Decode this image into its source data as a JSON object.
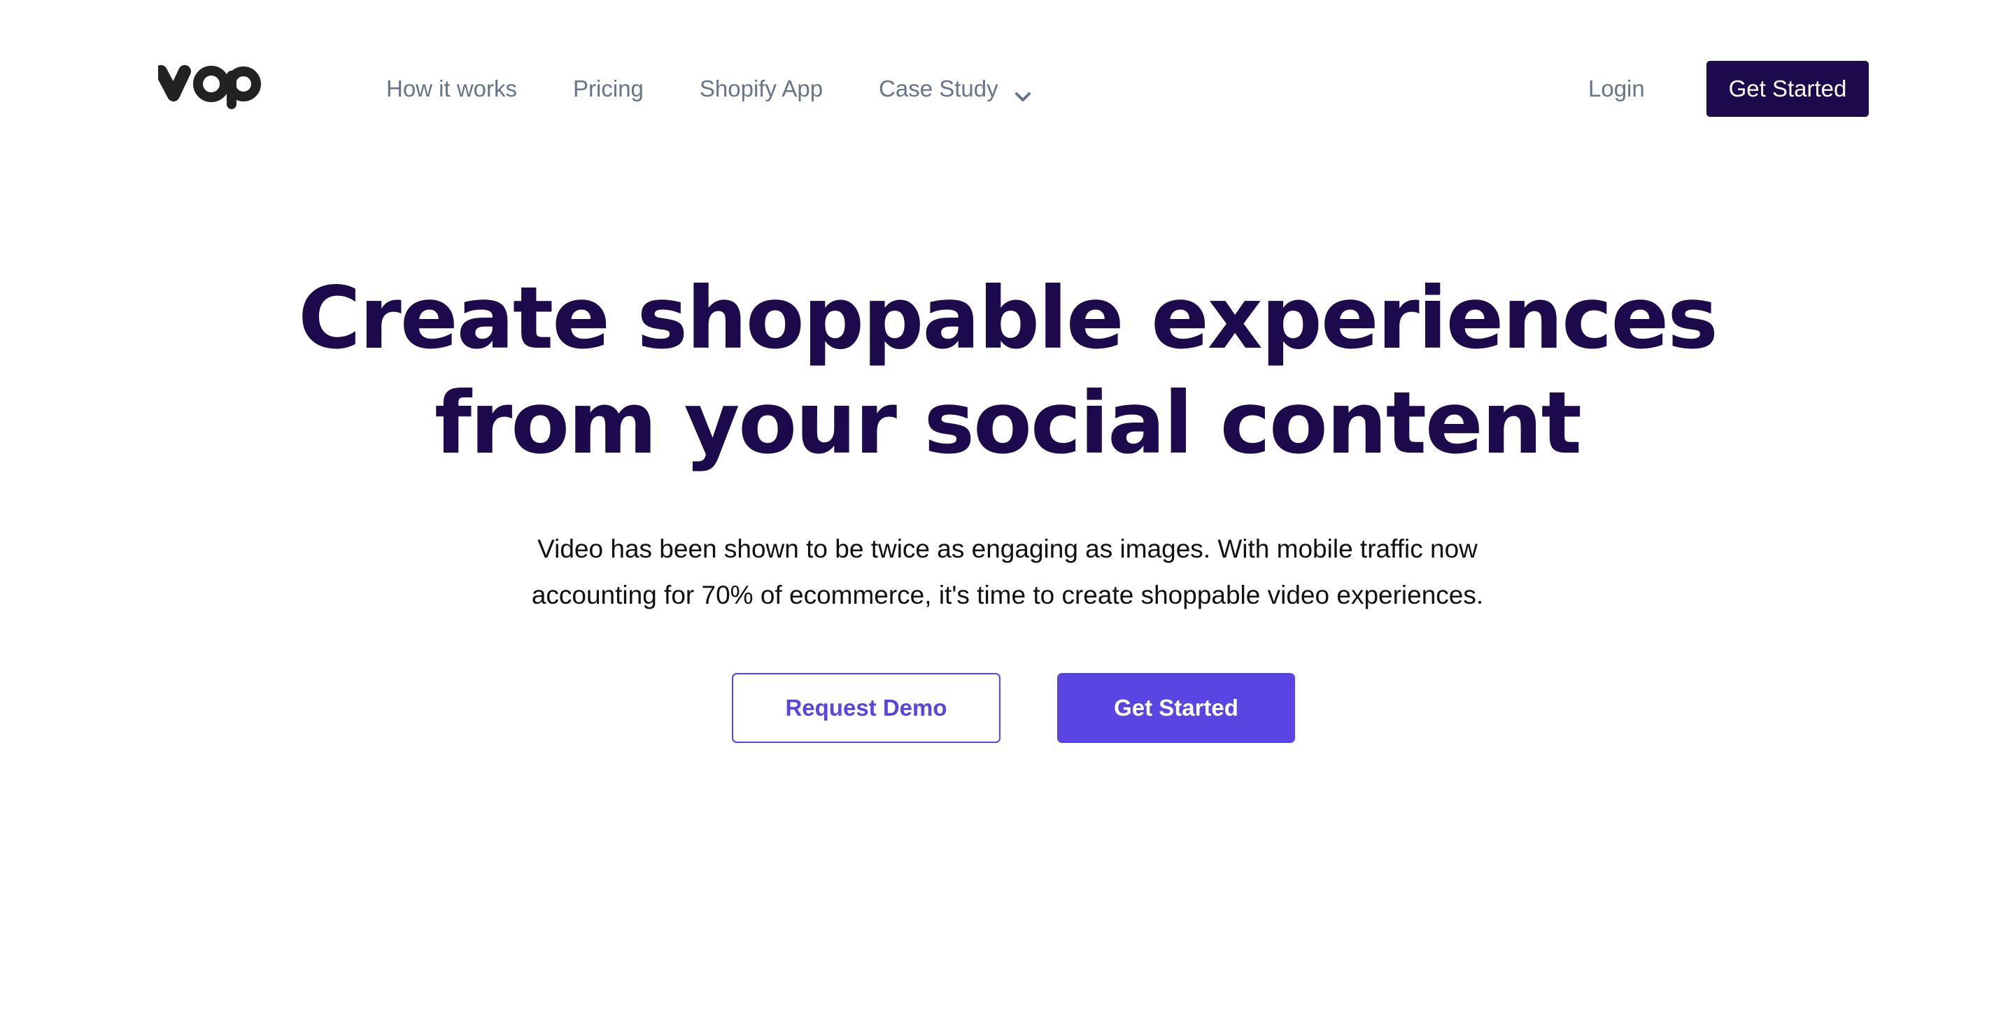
{
  "brand": {
    "logo_text": "vop",
    "logo_color": "#222222"
  },
  "nav": {
    "links": [
      {
        "label": "How it works"
      },
      {
        "label": "Pricing"
      },
      {
        "label": "Shopify App"
      },
      {
        "label": "Case Study",
        "has_dropdown": true,
        "dropdown_icon": "chevron-down-icon"
      }
    ],
    "login_label": "Login",
    "cta_label": "Get Started"
  },
  "hero": {
    "title_line1": "Create shoppable experiences",
    "title_line2": "from your social content",
    "subtitle_line1": "Video has been shown to be twice as engaging as images. With mobile traffic now",
    "subtitle_line2": "accounting for 70% of ecommerce, it's time to create shoppable video experiences.",
    "secondary_button_label": "Request Demo",
    "primary_button_label": "Get Started"
  },
  "colors": {
    "brand_dark": "#1d0a4c",
    "accent": "#5b45e2",
    "nav_text": "#677489",
    "body_text": "#111111",
    "background": "#ffffff"
  }
}
